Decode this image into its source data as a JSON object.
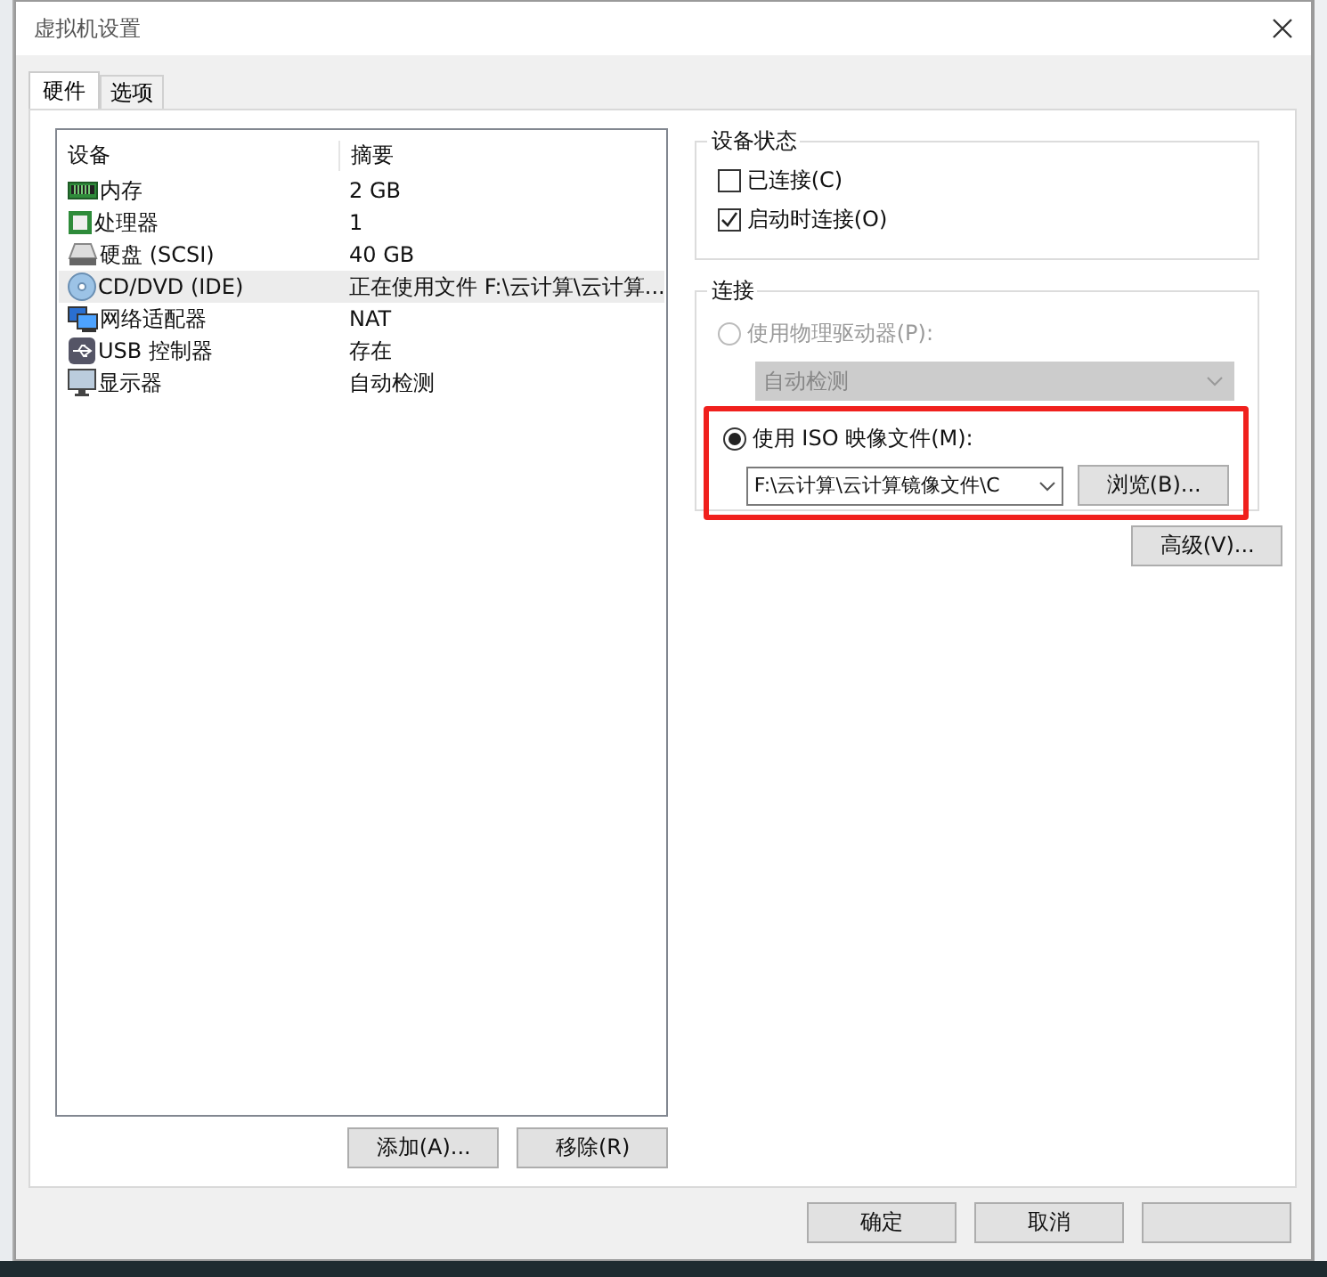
{
  "window": {
    "title": "虚拟机设置"
  },
  "tabs": [
    {
      "label": "硬件",
      "selected": true
    },
    {
      "label": "选项",
      "selected": false
    }
  ],
  "devices": {
    "columns": [
      "设备",
      "摘要"
    ],
    "rows": [
      {
        "kind": "memory",
        "name": "内存",
        "summary": "2 GB",
        "selected": false
      },
      {
        "kind": "cpu",
        "name": "处理器",
        "summary": "1",
        "selected": false
      },
      {
        "kind": "disk",
        "name": "硬盘 (SCSI)",
        "summary": "40 GB",
        "selected": false
      },
      {
        "kind": "cdrom",
        "name": "CD/DVD (IDE)",
        "summary": "正在使用文件 F:\\云计算\\云计算...",
        "selected": true
      },
      {
        "kind": "network",
        "name": "网络适配器",
        "summary": "NAT",
        "selected": false
      },
      {
        "kind": "usb",
        "name": "USB 控制器",
        "summary": "存在",
        "selected": false
      },
      {
        "kind": "display",
        "name": "显示器",
        "summary": "自动检测",
        "selected": false
      }
    ]
  },
  "list_buttons": [
    "添加(A)...",
    "移除(R)"
  ],
  "device_status": {
    "title": "设备状态",
    "options": [
      {
        "label": "已连接(C)",
        "checked": false
      },
      {
        "label": "启动时连接(O)",
        "checked": true
      }
    ]
  },
  "connection": {
    "title": "连接",
    "physical": {
      "label": "使用物理驱动器(P):",
      "selected": false,
      "disabled": true,
      "drive": "自动检测"
    },
    "iso": {
      "label": "使用 ISO 映像文件(M):",
      "selected": true,
      "file": "F:\\云计算\\云计算镜像文件\\C",
      "browse": "浏览(B)...",
      "highlighted": true
    }
  },
  "advanced_button": "高级(V)...",
  "dialog_buttons": [
    "确定",
    "取消"
  ]
}
